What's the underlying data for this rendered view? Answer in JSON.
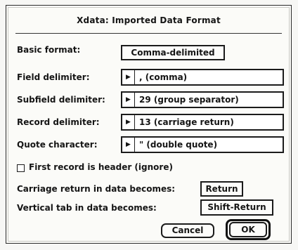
{
  "dialog": {
    "title": "Xdata: Imported Data Format"
  },
  "basic_format": {
    "label": "Basic format:",
    "button": "Comma-delimited"
  },
  "fields": [
    {
      "label": "Field delimiter:",
      "value": ",   (comma)"
    },
    {
      "label": "Subfield delimiter:",
      "value": "29 (group separator)"
    },
    {
      "label": "Record delimiter:",
      "value": "13 (carriage return)"
    },
    {
      "label": "Quote character:",
      "value": "\"   (double quote)"
    }
  ],
  "header_checkbox": {
    "label": "First record is header (ignore)",
    "checked": false
  },
  "carriage_return": {
    "label": "Carriage return in data becomes:",
    "button": "Return"
  },
  "vertical_tab": {
    "label": "Vertical tab in data becomes:",
    "button": "Shift-Return"
  },
  "buttons": {
    "cancel": "Cancel",
    "ok": "OK"
  },
  "icons": {
    "dropdown": "triangle-right-icon",
    "checkbox": "checkbox-icon"
  },
  "colors": {
    "background": "#f7f7f5",
    "border": "#1b1b1b",
    "text": "#151515"
  }
}
